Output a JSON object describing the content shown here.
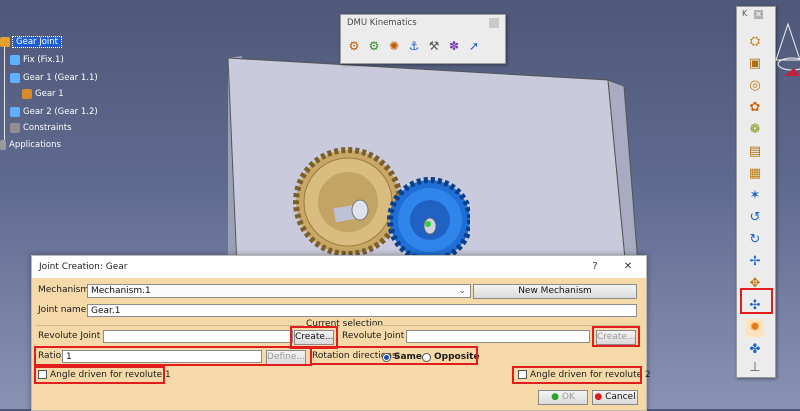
{
  "tree": {
    "root": "Gear Joint",
    "items": [
      "Fix (Fix.1)",
      "Gear 1 (Gear 1.1)",
      "Gear 1",
      "Gear 2 (Gear 1.2)",
      "Constraints",
      "Applications"
    ]
  },
  "dmu_toolbar": {
    "title": "DMU Kinematics"
  },
  "right_toolbar": {
    "title": "K"
  },
  "dialog": {
    "title": "Joint Creation: Gear",
    "help_glyph": "?",
    "close_glyph": "✕",
    "mechanism_label": "Mechanism:",
    "mechanism_value": "Mechanism.1",
    "new_mechanism": "New Mechanism",
    "joint_name_label": "Joint name:",
    "joint_name_value": "Gear.1",
    "current_selection": "Current selection",
    "revolute1_label": "Revolute Joint 1:",
    "revolute1_value": "",
    "create1": "Create...",
    "revolute2_label": "Revolute Joint 2:",
    "revolute2_value": "",
    "create2": "Create...",
    "ratio_label": "Ratio:",
    "ratio_value": "1",
    "define": "Define...",
    "rotation_label": "Rotation directions:",
    "same": "Same",
    "opposite": "Opposite",
    "angle1": "Angle driven for revolute 1",
    "angle2": "Angle driven for revolute 2",
    "ok": "OK",
    "cancel": "Cancel"
  },
  "colors": {
    "highlight": "#e21d1d",
    "dialog_bg": "#f6d9a8",
    "selection": "#1e5fd6"
  }
}
